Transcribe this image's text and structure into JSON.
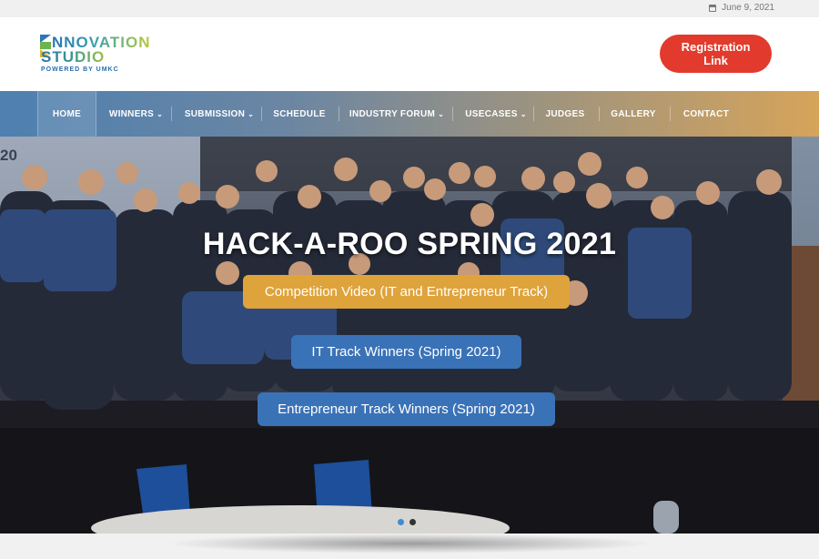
{
  "topbar": {
    "date": "June 9, 2021"
  },
  "logo": {
    "word1": "NNOVATION",
    "word2": "STUDIO",
    "tagline": "POWERED BY UMKC"
  },
  "header": {
    "registration_label": "Registration Link",
    "registration_color": "#e23a2c"
  },
  "nav": {
    "items": [
      {
        "label": "HOME",
        "dropdown": false,
        "active": true
      },
      {
        "label": "WINNERS",
        "dropdown": true
      },
      {
        "label": "SUBMISSION",
        "dropdown": true
      },
      {
        "label": "SCHEDULE",
        "dropdown": false
      },
      {
        "label": "INDUSTRY FORUM",
        "dropdown": true
      },
      {
        "label": "USECASES",
        "dropdown": true
      },
      {
        "label": "JUDGES",
        "dropdown": false
      },
      {
        "label": "GALLERY",
        "dropdown": false
      },
      {
        "label": "CONTACT",
        "dropdown": false
      }
    ],
    "chevron": "⌄"
  },
  "hero": {
    "title": "HACK-A-ROO SPRING 2021",
    "buttons": [
      {
        "label": "Competition Video (IT and Entrepreneur Track)",
        "color": "#dfa33b"
      },
      {
        "label": "IT Track Winners (Spring 2021)",
        "color": "#3a72b7"
      },
      {
        "label": "Entrepreneur Track Winners (Spring 2021)",
        "color": "#3a72b7"
      }
    ],
    "corner_text": "20",
    "slides": 2,
    "active_slide": 0
  }
}
